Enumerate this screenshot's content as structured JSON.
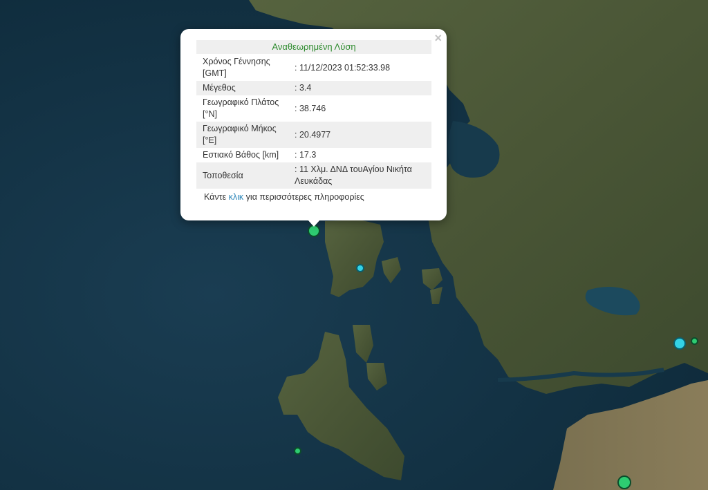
{
  "colors": {
    "sea": "#123445",
    "land": "#4b5a3a",
    "marker_green": "#2ecc71",
    "marker_cyan": "#34d3e6",
    "popup_title": "#2e8b2e",
    "link": "#2a84b8"
  },
  "map": {
    "markers": [
      {
        "color": "green",
        "label": "selected-event"
      },
      {
        "color": "cyan",
        "label": "event"
      },
      {
        "color": "cyan",
        "label": "event"
      },
      {
        "color": "green",
        "label": "event"
      },
      {
        "color": "green",
        "label": "event"
      },
      {
        "color": "green",
        "label": "event"
      }
    ]
  },
  "popup": {
    "close": "×",
    "title": "Αναθεωρημένη Λύση",
    "rows": [
      {
        "label": "Χρόνος Γέννησης [GMT]",
        "value": ": 11/12/2023 01:52:33.98"
      },
      {
        "label": "Μέγεθος",
        "value": ": 3.4"
      },
      {
        "label": "Γεωγραφικό Πλάτος [°N]",
        "value": ": 38.746"
      },
      {
        "label": "Γεωγραφικό Μήκος [°E]",
        "value": ": 20.4977"
      },
      {
        "label": "Εστιακό Βάθος [km]",
        "value": ": 17.3"
      },
      {
        "label": "Τοποθεσία",
        "value": ": 11 Χλμ. ΔΝΔ τουΑγίου Νικήτα Λευκάδας"
      }
    ],
    "more_prefix": "Κάντε ",
    "more_link": "κλικ",
    "more_suffix": " για περισσότερες πληροφορίες"
  }
}
